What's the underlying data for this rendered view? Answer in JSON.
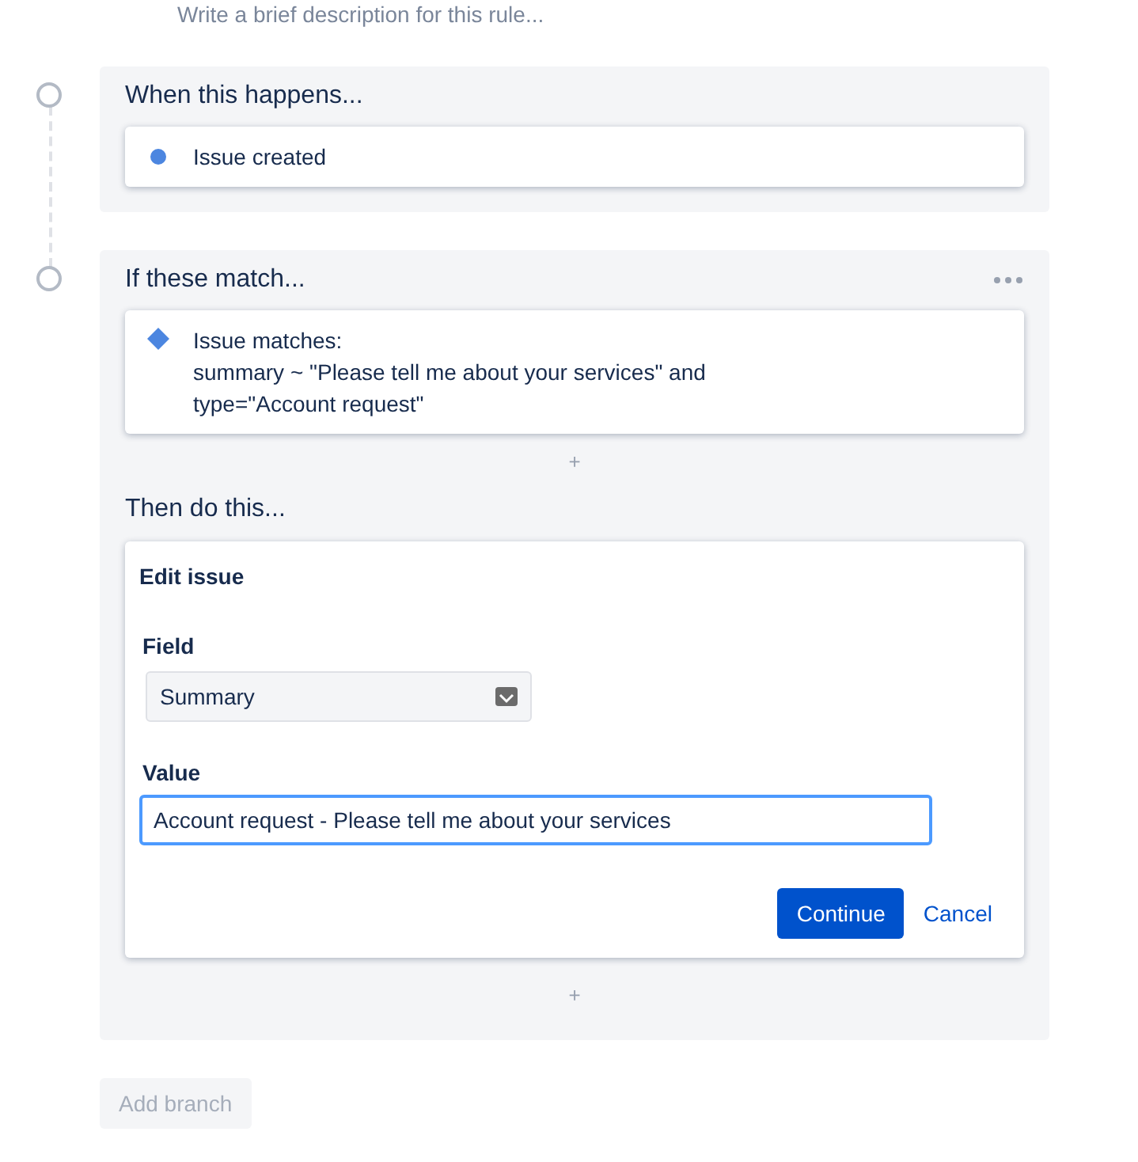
{
  "rule_description": {
    "placeholder": "Write a brief description for this rule..."
  },
  "steps": [
    {
      "kind": "trigger",
      "title": "When this happens...",
      "items": [
        {
          "kind": "dot",
          "color": "#4c86e0",
          "lines": [
            "Issue created"
          ]
        }
      ]
    },
    {
      "kind": "condition",
      "title": "If these match...",
      "items": [
        {
          "kind": "diamond",
          "color": "#4c86e0",
          "lines": [
            "Issue matches:",
            "summary ~ \"Please tell me about your services\" and",
            "type=\"Account request\""
          ]
        }
      ],
      "add": "+",
      "action": {
        "title": "Then do this...",
        "card_title": "Edit issue",
        "field_label": "Field",
        "field_value": "Summary",
        "value_label": "Value",
        "value": "Account request - Please tell me about your services",
        "focused": true,
        "primary_button": "Continue",
        "secondary_button": "Cancel"
      },
      "add_after": "+"
    }
  ],
  "add_branch": {
    "label": "Add branch",
    "disabled": true
  }
}
